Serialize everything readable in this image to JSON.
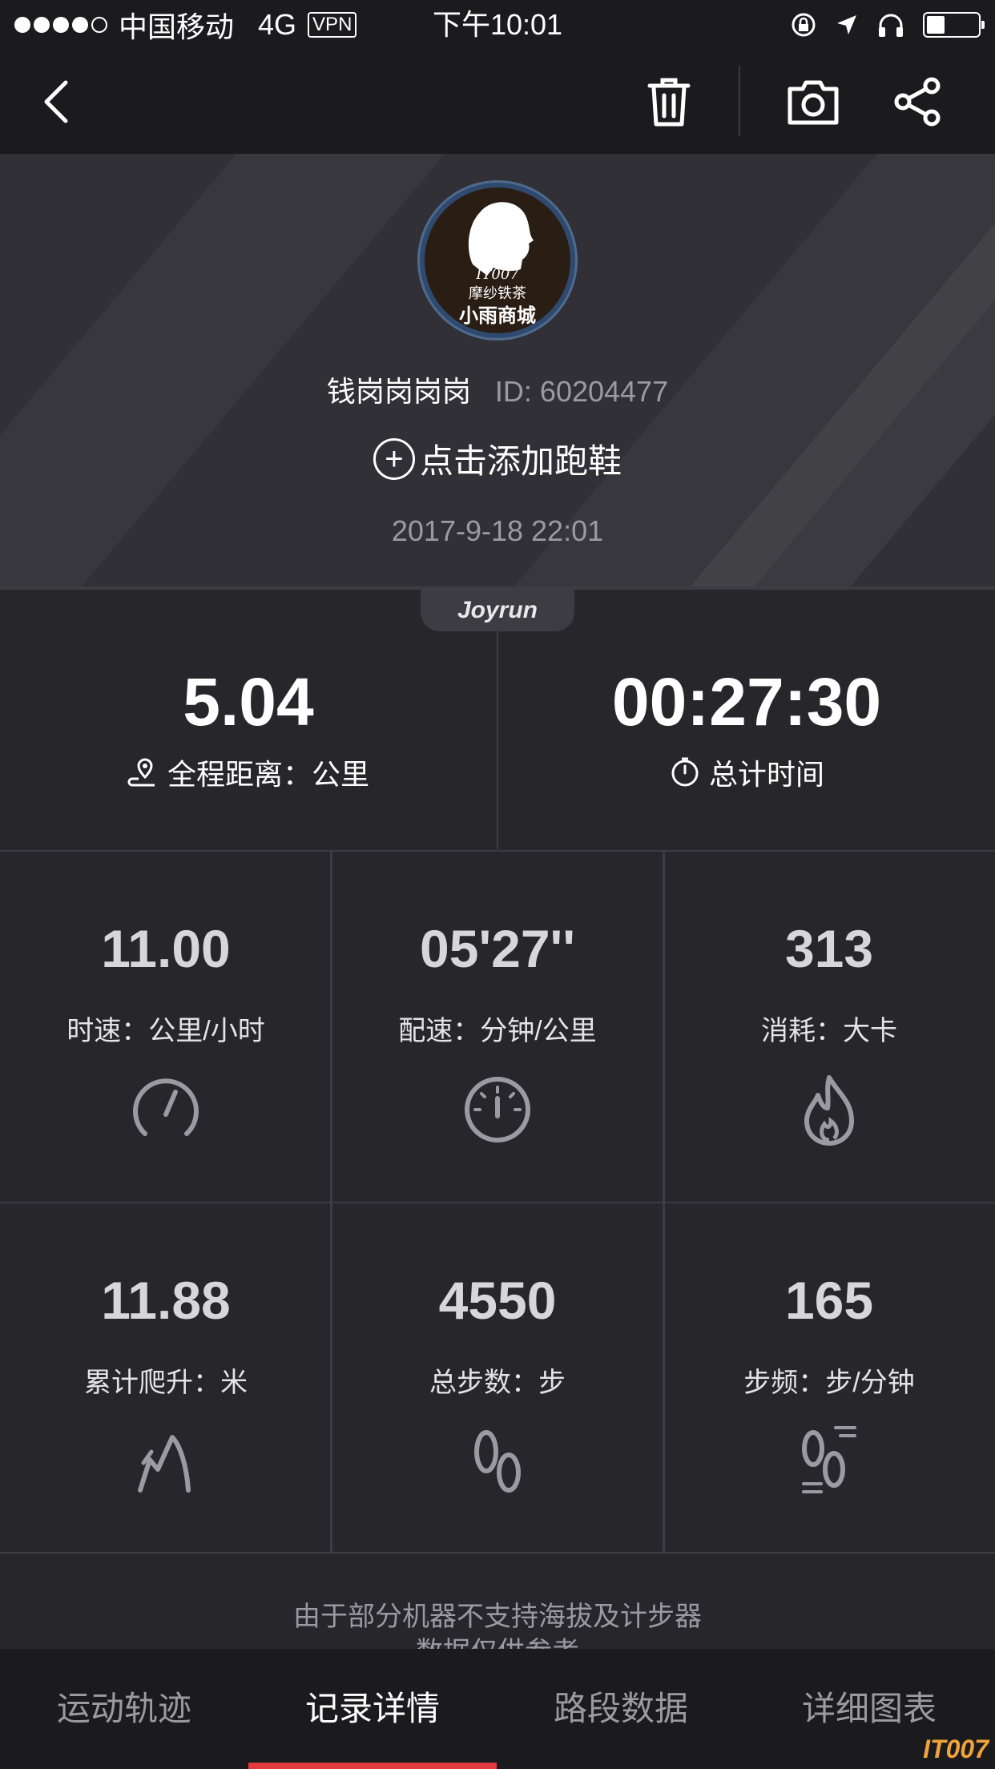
{
  "status_bar": {
    "carrier": "中国移动",
    "network": "4G",
    "vpn": "VPN",
    "time": "下午10:01",
    "battery_level": 0.35
  },
  "nav": {
    "back_icon": "chevron-left-icon",
    "delete_icon": "trash-icon",
    "camera_icon": "camera-icon",
    "share_icon": "share-icon"
  },
  "profile": {
    "avatar_lines": [
      "IT007",
      "摩纱铁茶",
      "小雨商城"
    ],
    "username": "钱岗岗岗岗",
    "user_id": "ID: 60204477",
    "add_shoe": "点击添加跑鞋",
    "date": "2017-9-18 22:01",
    "brand": "Joyrun"
  },
  "summary": {
    "distance": {
      "value": "5.04",
      "label": "全程距离：公里",
      "icon": "route-pin-icon"
    },
    "duration": {
      "value": "00:27:30",
      "label": "总计时间",
      "icon": "stopwatch-icon"
    }
  },
  "metrics": [
    {
      "value": "11.00",
      "label": "时速：公里/小时",
      "icon": "speedometer-icon"
    },
    {
      "value": "05'27''",
      "label": "配速：分钟/公里",
      "icon": "gauge-icon"
    },
    {
      "value": "313",
      "label": "消耗：大卡",
      "icon": "flame-icon"
    },
    {
      "value": "11.88",
      "label": "累计爬升：米",
      "icon": "climb-icon"
    },
    {
      "value": "4550",
      "label": "总步数：步",
      "icon": "footprints-icon"
    },
    {
      "value": "165",
      "label": "步频：步/分钟",
      "icon": "cadence-icon"
    }
  ],
  "note": {
    "line1": "由于部分机器不支持海拔及计步器",
    "line2": "数据仅供参考"
  },
  "tabs": [
    {
      "label": "运动轨迹",
      "active": false
    },
    {
      "label": "记录详情",
      "active": true
    },
    {
      "label": "路段数据",
      "active": false
    },
    {
      "label": "详细图表",
      "active": false
    }
  ],
  "colors": {
    "accent": "#e33a3f",
    "background": "#26262b",
    "bar": "#1b1b1e"
  },
  "watermark": "IT007"
}
